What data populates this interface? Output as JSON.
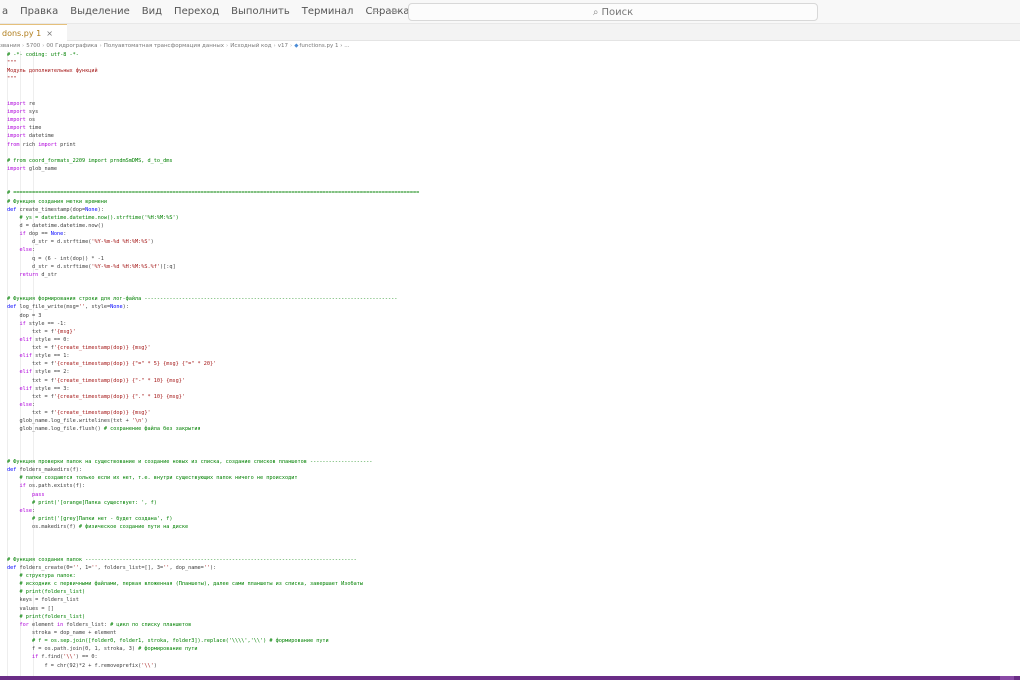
{
  "menu": [
    "а",
    "Правка",
    "Выделение",
    "Вид",
    "Переход",
    "Выполнить",
    "Терминал",
    "Справка"
  ],
  "nav": {
    "back": "←",
    "forward": "→"
  },
  "search": {
    "icon": "search-icon",
    "label": "Поиск"
  },
  "tab": {
    "label": "dons.py 1",
    "close": "×"
  },
  "breadcrumb": {
    "items": [
      "звания",
      "5700",
      "00 Гидрографика",
      "Полуавтоматная трансформация данных",
      "Исходный код",
      "v17"
    ],
    "file": "functions.py",
    "tail": "1 › ..."
  },
  "code": [
    "# -*- coding: utf-8 -*-",
    "\"\"\"",
    "Модуль дополнительных функций",
    "\"\"\"",
    "",
    "",
    "import re",
    "import sys",
    "import os",
    "import time",
    "import datetime",
    "from rich import print",
    "",
    "# from coord_formats_2209 import prndmSmDMS, d_to_dms",
    "import glob_name",
    "",
    "",
    "# ==================================================================================================================================",
    "# Функция создания метки времени",
    "def create_timestamp(dop=None):",
    "    # ys = datetime.datetime.now().strftime('%H:%M:%S')",
    "    d = datetime.datetime.now()",
    "    if dop == None:",
    "        d_str = d.strftime('%Y-%m-%d %H:%M:%S')",
    "    else:",
    "        q = (6 - int(dop)) * -1",
    "        d_str = d.strftime('%Y-%m-%d %H:%M:%S.%f')[:q]",
    "    return d_str",
    "",
    "",
    "# Функция формирования строки для лог-файла ---------------------------------------------------------------------------------",
    "def log_file_write(msg='', style=None):",
    "    dop = 3",
    "    if style == -1:",
    "        txt = f'{msg}'",
    "    elif style == 0:",
    "        txt = f'{create_timestamp(dop)} {msg}'",
    "    elif style == 1:",
    "        txt = f'{create_timestamp(dop)} {\"=\" * 5} {msg} {\"=\" * 20}'",
    "    elif style == 2:",
    "        txt = f'{create_timestamp(dop)} {\"-\" * 10} {msg}'",
    "    elif style == 3:",
    "        txt = f'{create_timestamp(dop)} {\".\" * 10} {msg}'",
    "    else:",
    "        txt = f'{create_timestamp(dop)} {msg}'",
    "    glob_name.log_file.writelines(txt + '\\n')",
    "    glob_name.log_file.flush() # сохранение файла без закрытия",
    "",
    "",
    "",
    "# Функция проверки папок на существование и создание новых из списка, создание списков планшетов --------------------",
    "def folders_makedirs(f):",
    "    # папки создаются только если их нет, т.е. внутри существующих папок ничего не происходит",
    "    if os.path.exists(f):",
    "        pass",
    "        # print('[orange]Папка существует: ', f)",
    "    else:",
    "        # print('[grey]Папки нет - будет создана', f)",
    "        os.makedirs(f) # физическое создание пути на диске",
    "",
    "",
    "",
    "# Функция создания папок ---------------------------------------------------------------------------------------",
    "def folders_create(folder0='', folder1='', folders_list=[], folder3='', dop_name=''):",
    "    # структура папок:",
    "    # исходник с первичными файлами, первая вложенная (Планшеты), далее сами планшеты из списка, завершает Изобаты",
    "    # print(folders_list)",
    "    keys = folders_list",
    "    values = []",
    "    # print(folders_list)",
    "    for element in folders_list: # цикл по списку планшетов",
    "        stroka = dop_name + element",
    "        # f = os.sep.join([folder0, folder1, stroka, folder3]).replace('\\\\\\\\','\\\\') # формирование пути",
    "        f = os.path.join(folder0, folder1, stroka, folder3) # формирование пути",
    "        if f.find('\\\\') == 0:",
    "            f = chr(92)*2 + f.removeprefix('\\\\')"
  ],
  "colors": {
    "keyword": "#0000ff",
    "control": "#af00db",
    "comment": "#008000",
    "docstring": "#a31515",
    "string": "#a31515",
    "statusbar": "#6a2d86"
  }
}
